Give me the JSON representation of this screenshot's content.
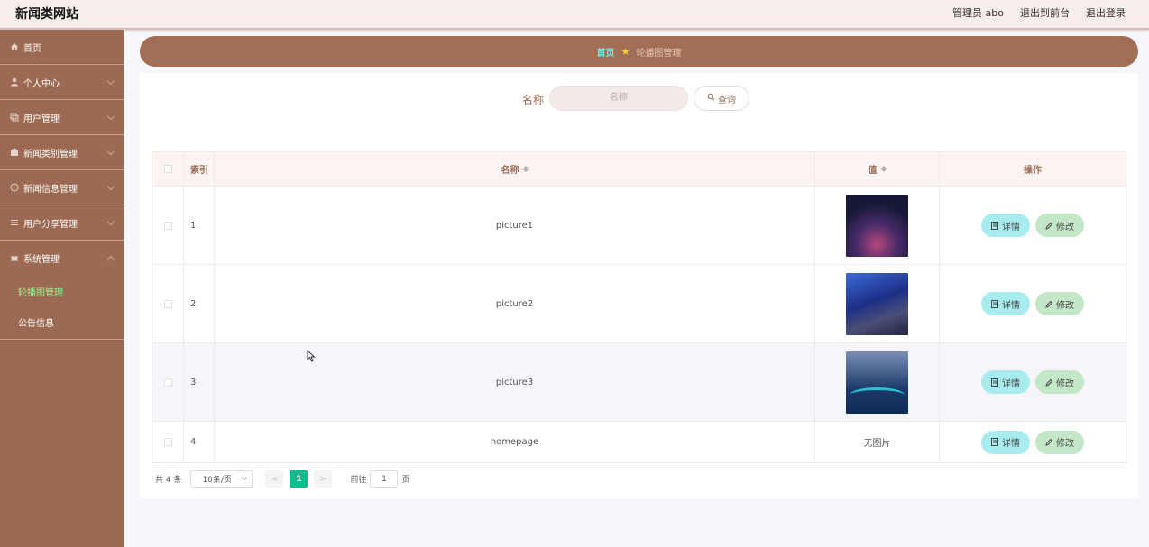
{
  "header": {
    "brand": "新闻类网站",
    "admin_label": "管理员 abo",
    "to_front": "退出到前台",
    "logout": "退出登录"
  },
  "sidebar": {
    "items": [
      {
        "label": "首页",
        "icon": "home-icon"
      },
      {
        "label": "个人中心",
        "icon": "user-icon"
      },
      {
        "label": "用户管理",
        "icon": "copy-icon"
      },
      {
        "label": "新闻类别管理",
        "icon": "briefcase-icon"
      },
      {
        "label": "新闻信息管理",
        "icon": "compass-icon"
      },
      {
        "label": "用户分享管理",
        "icon": "list-icon"
      },
      {
        "label": "系统管理",
        "icon": "ticket-icon"
      }
    ],
    "sub_items": [
      {
        "label": "轮播图管理",
        "active": true
      },
      {
        "label": "公告信息",
        "active": false
      }
    ]
  },
  "breadcrumb": {
    "home": "首页",
    "separator": "★",
    "current": "轮播图管理"
  },
  "search": {
    "label": "名称",
    "placeholder": "名称",
    "button": "查询"
  },
  "table": {
    "headers": {
      "index": "索引",
      "name": "名称",
      "value": "值",
      "actions": "操作"
    },
    "rows": [
      {
        "index": "1",
        "name": "picture1",
        "value_image": true,
        "detail": "详情",
        "edit": "修改"
      },
      {
        "index": "2",
        "name": "picture2",
        "value_image": true,
        "detail": "详情",
        "edit": "修改"
      },
      {
        "index": "3",
        "name": "picture3",
        "value_image": true,
        "detail": "详情",
        "edit": "修改"
      },
      {
        "index": "4",
        "name": "homepage",
        "value_text": "无图片",
        "detail": "详情",
        "edit": "修改"
      }
    ]
  },
  "pagination": {
    "total": "共 4 条",
    "page_size": "10条/页",
    "prev": "<",
    "current_page": "1",
    "next": ">",
    "goto_label": "前往",
    "goto_value": "1",
    "page_suffix": "页"
  },
  "colors": {
    "sidebar": "#9c6a52",
    "breadcrumb_bar": "#a26e55",
    "detail_button": "#a9ecf0",
    "edit_button": "#c3e7c7",
    "active_page": "#13ba8d"
  }
}
